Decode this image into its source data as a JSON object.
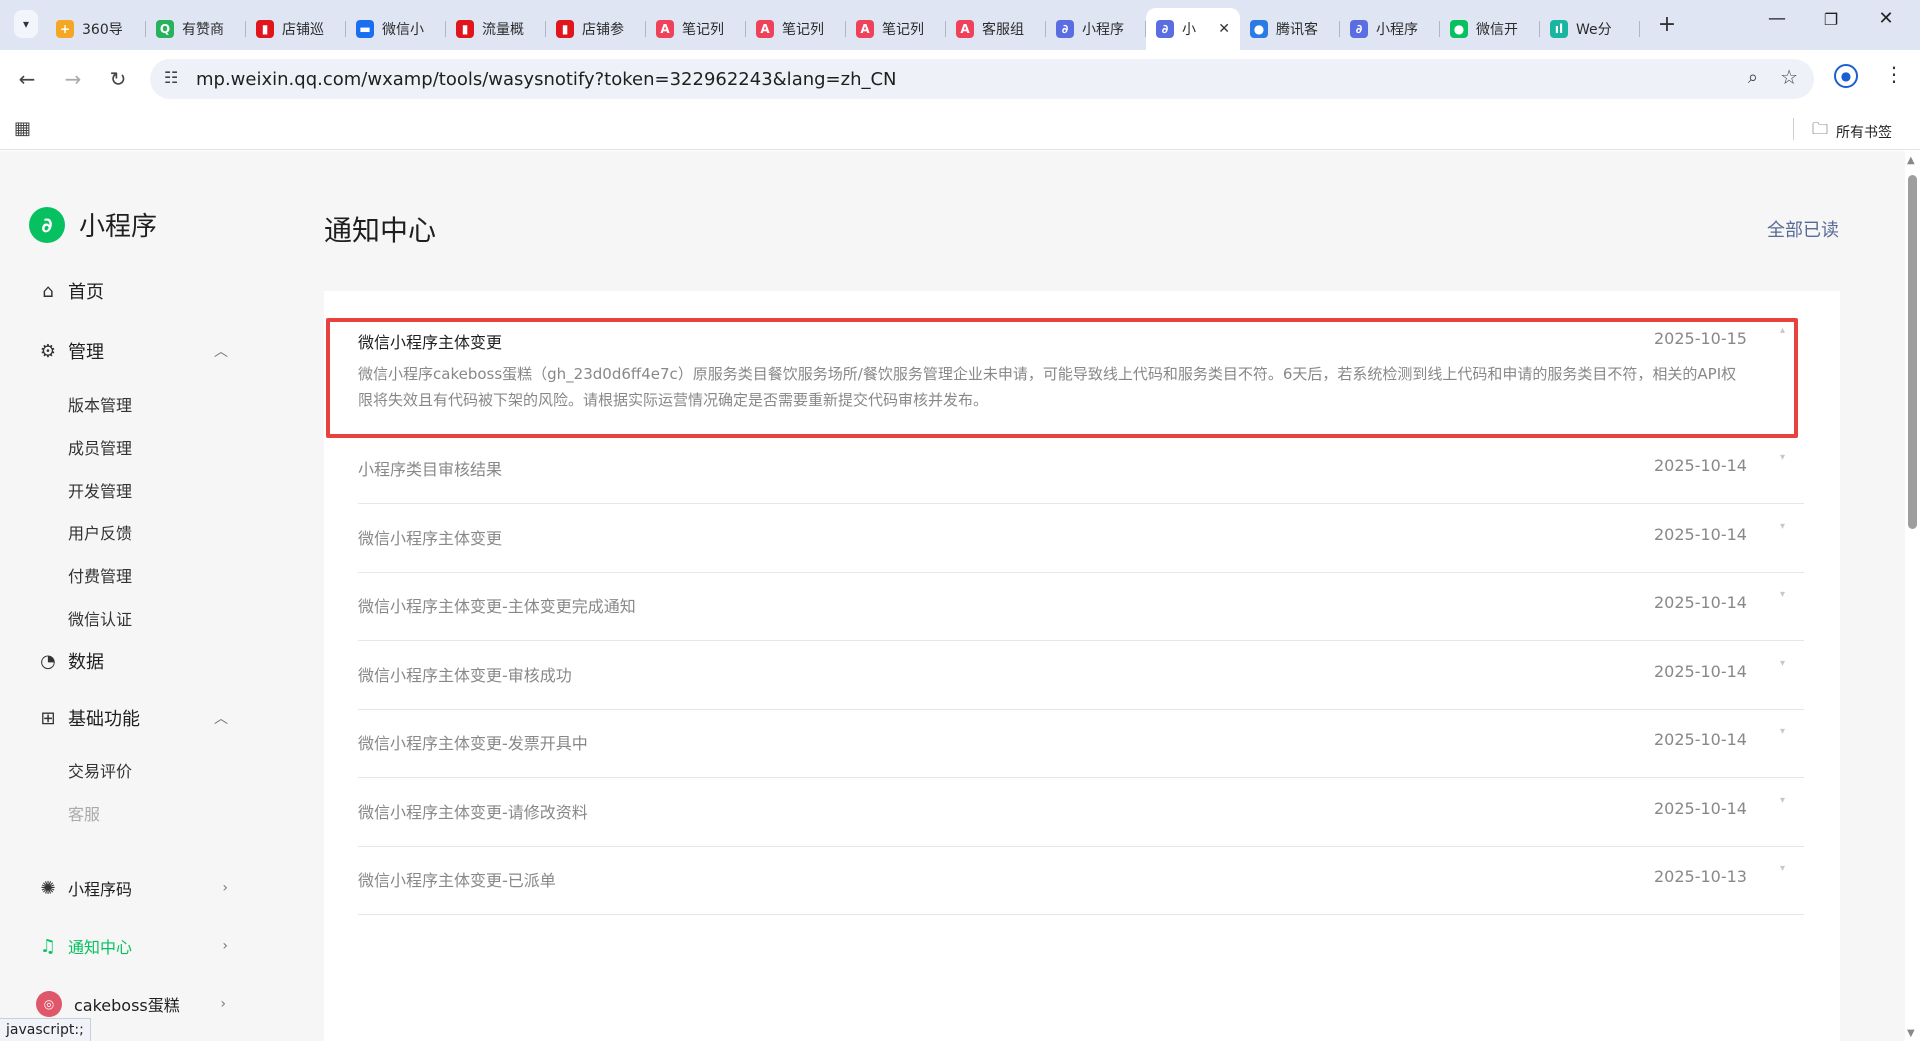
{
  "browser": {
    "tabs": [
      {
        "title": "360导",
        "fav_text": "+",
        "fav_color": "#f5a623"
      },
      {
        "title": "有赞商",
        "fav_text": "Q",
        "fav_color": "#28b25c"
      },
      {
        "title": "店铺巡",
        "fav_text": "▮",
        "fav_color": "#e0161c"
      },
      {
        "title": "微信小",
        "fav_text": "▬",
        "fav_color": "#1a6ef0"
      },
      {
        "title": "流量概",
        "fav_text": "▮",
        "fav_color": "#e0161c"
      },
      {
        "title": "店铺参",
        "fav_text": "▮",
        "fav_color": "#e0161c"
      },
      {
        "title": "笔记列",
        "fav_text": "A",
        "fav_color": "#f0415a"
      },
      {
        "title": "笔记列",
        "fav_text": "A",
        "fav_color": "#f0415a"
      },
      {
        "title": "笔记列",
        "fav_text": "A",
        "fav_color": "#f0415a"
      },
      {
        "title": "客服组",
        "fav_text": "A",
        "fav_color": "#f0415a"
      },
      {
        "title": "小程序",
        "fav_text": "∂",
        "fav_color": "#5b6ee1"
      },
      {
        "title": "小",
        "fav_text": "∂",
        "fav_color": "#5b6ee1",
        "active": true
      },
      {
        "title": "腾讯客",
        "fav_text": "●",
        "fav_color": "#2c7be5"
      },
      {
        "title": "小程序",
        "fav_text": "∂",
        "fav_color": "#5b6ee1"
      },
      {
        "title": "微信开",
        "fav_text": "●",
        "fav_color": "#07c160"
      },
      {
        "title": "We分",
        "fav_text": "ıl",
        "fav_color": "#18b5a0"
      }
    ],
    "close_glyph": "✕",
    "new_tab_glyph": "+",
    "url": "mp.weixin.qq.com/wxamp/tools/wasysnotify?token=322962243&lang=zh_CN",
    "bookmarks_all": "所有书签",
    "status_tip": "javascript:;"
  },
  "sidebar": {
    "logo_text": "小程序",
    "home": "首页",
    "manage": "管理",
    "manage_items": [
      "版本管理",
      "成员管理",
      "开发管理",
      "用户反馈",
      "付费管理",
      "微信认证"
    ],
    "data": "数据",
    "basic": "基础功能",
    "basic_items": [
      "交易评价",
      "客服"
    ],
    "qrcode": "小程序码",
    "notify": "通知中心",
    "account": "cakeboss蛋糕"
  },
  "main": {
    "title": "通知中心",
    "mark_all_read": "全部已读",
    "expanded": {
      "title": "微信小程序主体变更",
      "date": "2025-10-15",
      "body": "微信小程序cakeboss蛋糕（gh_23d0d6ff4e7c）原服务类目餐饮服务场所/餐饮服务管理企业未申请，可能导致线上代码和服务类目不符。6天后，若系统检测到线上代码和申请的服务类目不符，相关的API权限将失效且有代码被下架的风险。请根据实际运营情况确定是否需要重新提交代码审核并发布。"
    },
    "notifications": [
      {
        "title": "小程序类目审核结果",
        "date": "2025-10-14"
      },
      {
        "title": "微信小程序主体变更",
        "date": "2025-10-14"
      },
      {
        "title": "微信小程序主体变更-主体变更完成通知",
        "date": "2025-10-14"
      },
      {
        "title": "微信小程序主体变更-审核成功",
        "date": "2025-10-14"
      },
      {
        "title": "微信小程序主体变更-发票开具中",
        "date": "2025-10-14"
      },
      {
        "title": "微信小程序主体变更-请修改资料",
        "date": "2025-10-14"
      },
      {
        "title": "微信小程序主体变更-已派单",
        "date": "2025-10-13"
      }
    ]
  },
  "colors": {
    "accent": "#07c160",
    "link": "#576b95",
    "highlight_box": "#e8423f"
  }
}
